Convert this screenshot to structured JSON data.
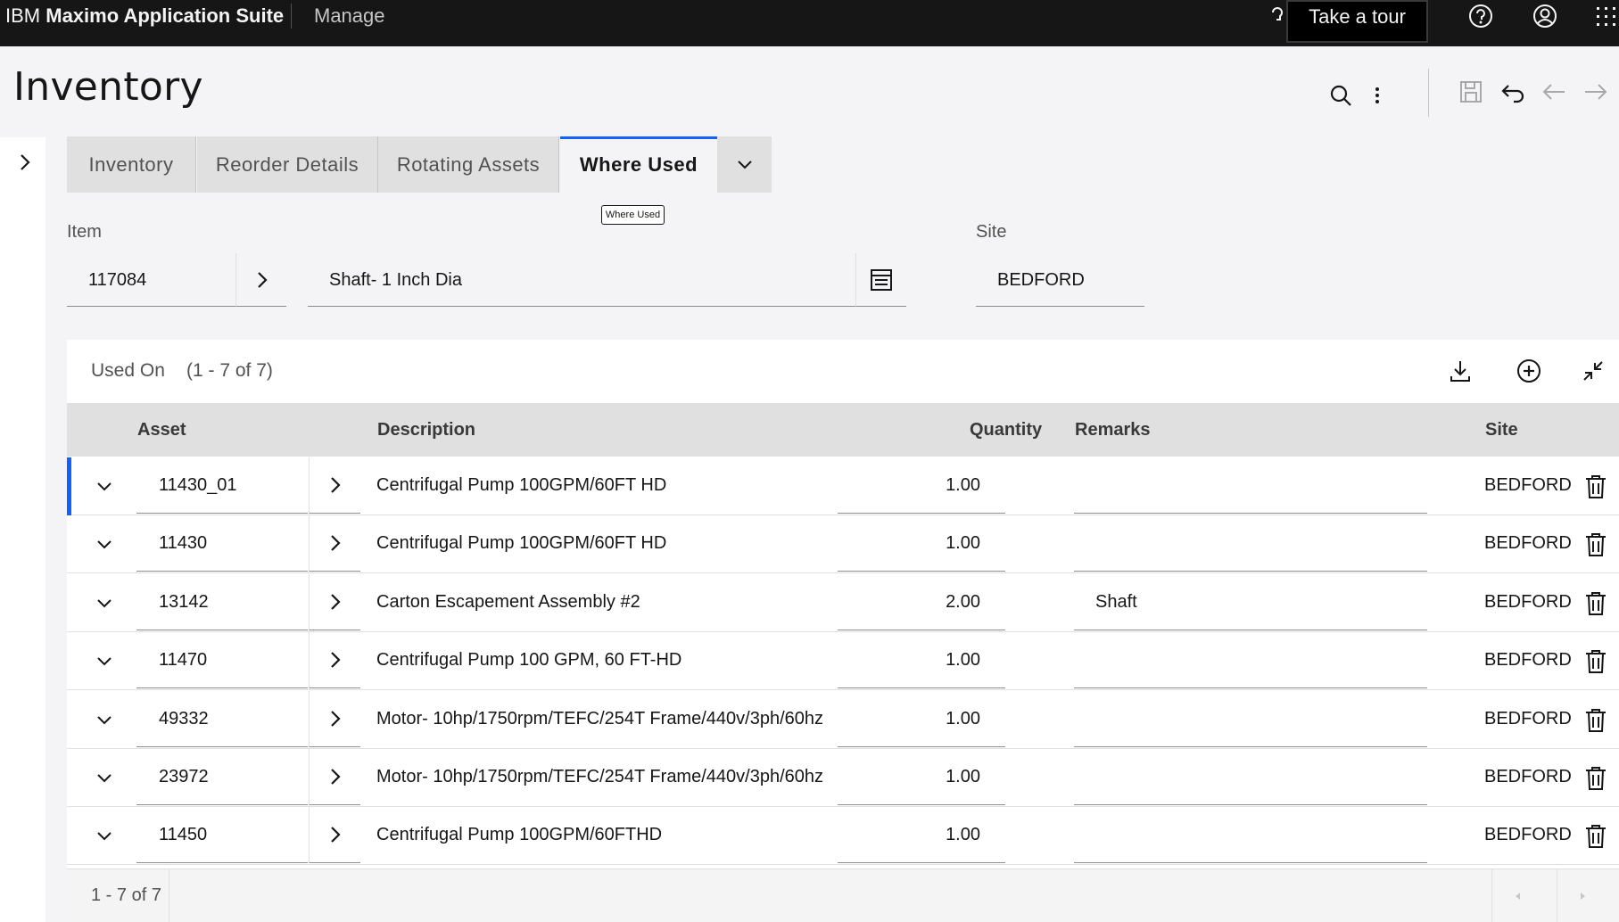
{
  "topbar": {
    "brand_prefix": "IBM",
    "brand_name": "Maximo Application Suite",
    "module": "Manage",
    "tour_button": "Take a tour",
    "icons": [
      "help-icon",
      "user-profile-icon",
      "app-switcher-icon"
    ]
  },
  "header": {
    "title": "Inventory",
    "icons": [
      "search-icon",
      "overflow-menu-icon",
      "save-icon",
      "undo-icon",
      "previous-arrow-icon",
      "next-arrow-icon"
    ]
  },
  "tabs": [
    {
      "label": "Inventory"
    },
    {
      "label": "Reorder Details"
    },
    {
      "label": "Rotating Assets"
    },
    {
      "label": "Where Used",
      "active": true
    }
  ],
  "tooltip": "Where Used",
  "item": {
    "label": "Item",
    "number": "117084",
    "description": "Shaft- 1 Inch Dia"
  },
  "site_field": {
    "label": "Site",
    "value": "BEDFORD"
  },
  "table": {
    "title": "Used On",
    "count": "(1 - 7 of 7)",
    "columns": {
      "asset": "Asset",
      "description": "Description",
      "quantity": "Quantity",
      "remarks": "Remarks",
      "site": "Site"
    },
    "rows": [
      {
        "asset": "11430_01",
        "description": "Centrifugal Pump 100GPM/60FT HD",
        "quantity": "1.00",
        "remarks": "",
        "site": "BEDFORD"
      },
      {
        "asset": "11430",
        "description": "Centrifugal Pump 100GPM/60FT HD",
        "quantity": "1.00",
        "remarks": "",
        "site": "BEDFORD"
      },
      {
        "asset": "13142",
        "description": "Carton Escapement Assembly #2",
        "quantity": "2.00",
        "remarks": "Shaft",
        "site": "BEDFORD"
      },
      {
        "asset": "11470",
        "description": "Centrifugal Pump 100 GPM, 60 FT-HD",
        "quantity": "1.00",
        "remarks": "",
        "site": "BEDFORD"
      },
      {
        "asset": "49332",
        "description": "Motor- 10hp/1750rpm/TEFC/254T Frame/440v/3ph/60hz",
        "quantity": "1.00",
        "remarks": "",
        "site": "BEDFORD"
      },
      {
        "asset": "23972",
        "description": "Motor- 10hp/1750rpm/TEFC/254T Frame/440v/3ph/60hz",
        "quantity": "1.00",
        "remarks": "",
        "site": "BEDFORD"
      },
      {
        "asset": "11450",
        "description": "Centrifugal Pump 100GPM/60FTHD",
        "quantity": "1.00",
        "remarks": "",
        "site": "BEDFORD"
      }
    ],
    "footer_count": "1 - 7 of 7"
  },
  "colors": {
    "topbar_bg": "#161616",
    "accent": "#0f62fe",
    "header_row_bg": "#e0e0e0"
  }
}
